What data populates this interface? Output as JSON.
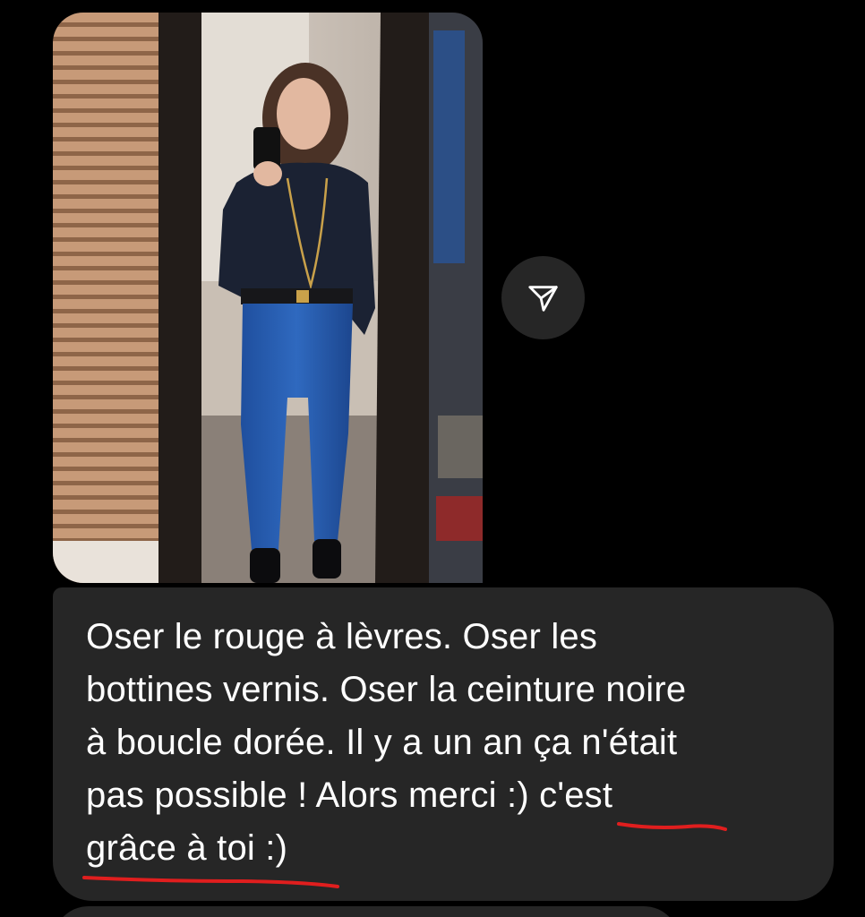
{
  "conversation": {
    "photo_message": {
      "alt": ""
    },
    "share_button": {
      "icon": "paper-plane-icon"
    },
    "text_message": {
      "lines": [
        "Oser le rouge à lèvres. Oser les",
        "bottines vernis. Oser la ceinture noire",
        "à boucle dorée. Il y a un an ça n'était",
        "pas possible ! Alors merci :) c'est",
        "grâce à toi :)"
      ],
      "underline_color": "#e01e1e"
    }
  },
  "colors": {
    "background": "#000000",
    "bubble": "#262626",
    "text": "#ffffff"
  }
}
